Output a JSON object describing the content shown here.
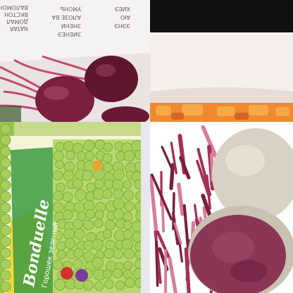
{
  "collage": {
    "tiles": [
      {
        "id": "beets-with-label",
        "subject": "red beets with stems lying under a printed label"
      },
      {
        "id": "carrot-bowl",
        "subject": "white bowl with orange carrot pieces"
      },
      {
        "id": "pea-package",
        "subject": "package of green peas"
      },
      {
        "id": "beet-julienne",
        "subject": "raw beet julienne strips beside whole and halved beets"
      }
    ],
    "label_lines": [
      "ВАЛОМОНО",
      "ВКСТОН",
      "ДОМАЛ",
      "NATAR",
      "УМОНЬ",
      "АЛОЗЕ ВА",
      "ЗНЕНИ",
      "ЗИЕНЕЭ",
      "ХИЕЭ",
      "АЮ",
      "ЭЭНЭ"
    ],
    "package": {
      "brand": "Bonduelle",
      "product": "Горошек зеленый"
    },
    "colors": {
      "beet": "#7a1f3d",
      "beet_dark": "#4d0f26",
      "stem": "#c24a74",
      "pea": "#a8cf5c",
      "carrot": "#ee8a2f",
      "package_green": "#2f8a3a",
      "bowl": "#f3f1ee"
    }
  }
}
